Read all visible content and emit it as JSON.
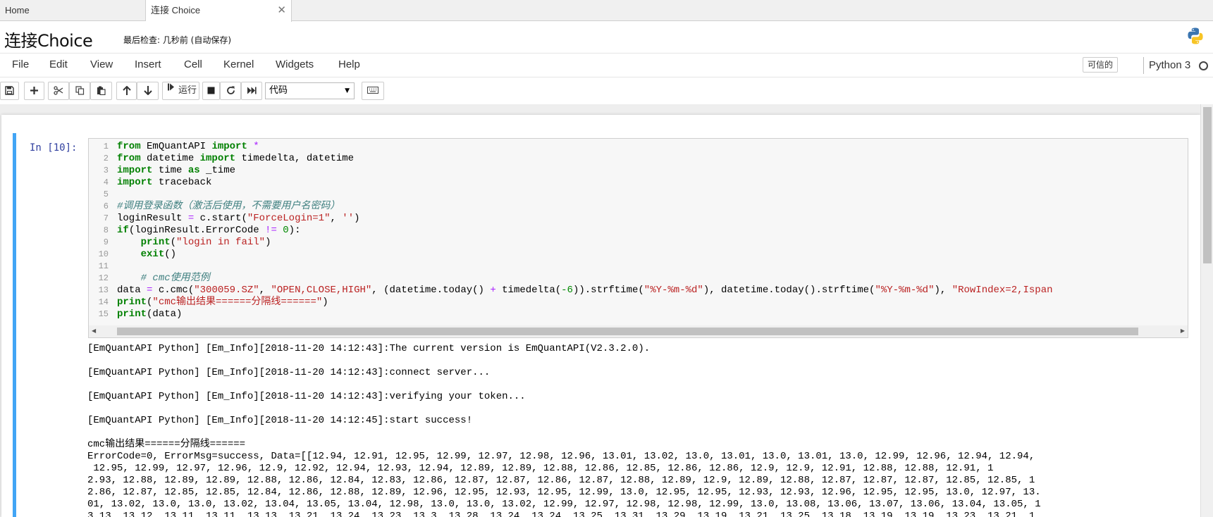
{
  "tabs": [
    {
      "label": "Home"
    },
    {
      "label": "连接 Choice"
    }
  ],
  "header": {
    "notebook_title": "连接Choice",
    "checkpoint": "最后检查: 几秒前  (自动保存)"
  },
  "menu": [
    "File",
    "Edit",
    "View",
    "Insert",
    "Cell",
    "Kernel",
    "Widgets",
    "Help"
  ],
  "status": {
    "trusted": "可信的",
    "kernel": "Python 3"
  },
  "toolbar": {
    "run_label": "运行",
    "cell_type": "代码"
  },
  "cell": {
    "prompt": "In [10]:",
    "code_lines": [
      "from EmQuantAPI import *",
      "from datetime import timedelta, datetime",
      "import time as _time",
      "import traceback",
      "",
      "#调用登录函数（激活后使用，不需要用户名密码）",
      "loginResult = c.start(\"ForceLogin=1\", '')",
      "if(loginResult.ErrorCode != 0):",
      "    print(\"login in fail\")",
      "    exit()",
      "",
      "    # cmc使用范例",
      "data = c.cmc(\"300059.SZ\", \"OPEN,CLOSE,HIGH\", (datetime.today() + timedelta(-6)).strftime(\"%Y-%m-%d\"), datetime.today().strftime(\"%Y-%m-%d\"), \"RowIndex=2,Ispan",
      "print(\"cmc输出结果======分隔线======\")",
      "print(data)"
    ],
    "output_lines": [
      "[EmQuantAPI Python] [Em_Info][2018-11-20 14:12:43]:The current version is EmQuantAPI(V2.3.2.0).",
      "",
      "[EmQuantAPI Python] [Em_Info][2018-11-20 14:12:43]:connect server...",
      "",
      "[EmQuantAPI Python] [Em_Info][2018-11-20 14:12:43]:verifying your token...",
      "",
      "[EmQuantAPI Python] [Em_Info][2018-11-20 14:12:45]:start success!",
      "",
      "cmc输出结果======分隔线======",
      "ErrorCode=0, ErrorMsg=success, Data=[[12.94, 12.91, 12.95, 12.99, 12.97, 12.98, 12.96, 13.01, 13.02, 13.0, 13.01, 13.0, 13.01, 13.0, 12.99, 12.96, 12.94, 12.94,",
      " 12.95, 12.99, 12.97, 12.96, 12.9, 12.92, 12.94, 12.93, 12.94, 12.89, 12.89, 12.88, 12.86, 12.85, 12.86, 12.86, 12.9, 12.9, 12.91, 12.88, 12.88, 12.91, 1",
      "2.93, 12.88, 12.89, 12.89, 12.88, 12.86, 12.84, 12.83, 12.86, 12.87, 12.87, 12.86, 12.87, 12.88, 12.89, 12.9, 12.89, 12.88, 12.87, 12.87, 12.87, 12.85, 12.85, 1",
      "2.86, 12.87, 12.85, 12.85, 12.84, 12.86, 12.88, 12.89, 12.96, 12.95, 12.93, 12.95, 12.99, 13.0, 12.95, 12.95, 12.93, 12.93, 12.96, 12.95, 12.95, 13.0, 12.97, 13.",
      "01, 13.02, 13.0, 13.0, 13.02, 13.04, 13.05, 13.04, 12.98, 13.0, 13.0, 13.02, 12.99, 12.97, 12.98, 12.98, 12.99, 13.0, 13.08, 13.06, 13.07, 13.06, 13.04, 13.05, 1",
      "3.13, 13.12, 13.11, 13.11, 13.13, 13.21, 13.24, 13.23, 13.3, 13.28, 13.24, 13.24, 13.25, 13.31, 13.29, 13.19, 13.21, 13.25, 13.18, 13.19, 13.19, 13.23, 13.21, 1"
    ]
  }
}
